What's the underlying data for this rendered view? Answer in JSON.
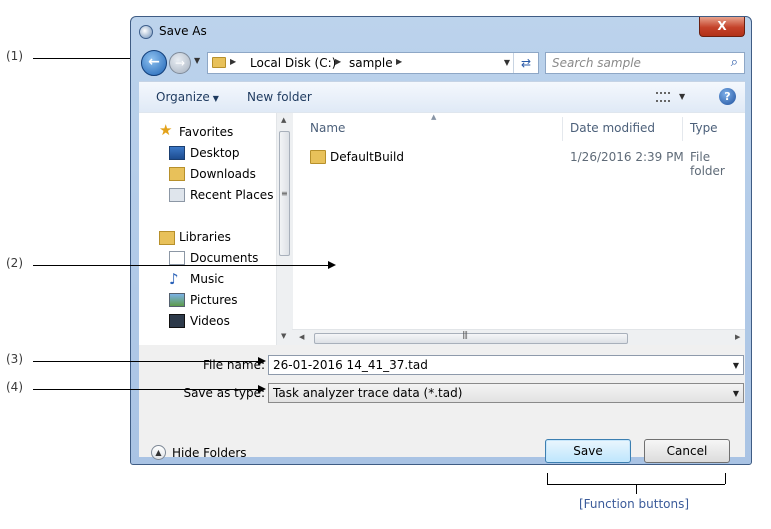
{
  "callouts": {
    "c1": "(1)",
    "c2": "(2)",
    "c3": "(3)",
    "c4": "(4)",
    "function_buttons": "[Function buttons]"
  },
  "window": {
    "title": "Save As",
    "close_glyph": "X"
  },
  "address": {
    "segments": [
      "Local Disk (C:)",
      "sample"
    ],
    "search_placeholder": "Search sample"
  },
  "toolbar": {
    "organize": "Organize",
    "new_folder": "New folder"
  },
  "nav": {
    "favorites": "Favorites",
    "desktop": "Desktop",
    "downloads": "Downloads",
    "recent_places": "Recent Places",
    "libraries": "Libraries",
    "documents": "Documents",
    "music": "Music",
    "pictures": "Pictures",
    "videos": "Videos"
  },
  "columns": {
    "name": "Name",
    "date_modified": "Date modified",
    "type": "Type"
  },
  "files": [
    {
      "name": "DefaultBuild",
      "date": "1/26/2016 2:39 PM",
      "type": "File folder"
    }
  ],
  "fields": {
    "file_name_label": "File name:",
    "file_name_value": "26-01-2016 14_41_37.tad",
    "save_as_type_label": "Save as type:",
    "save_as_type_value": "Task analyzer trace data (*.tad)"
  },
  "buttons": {
    "hide_folders": "Hide Folders",
    "save": "Save",
    "cancel": "Cancel"
  },
  "icons": {
    "back": "back-arrow-icon",
    "forward": "forward-arrow-icon",
    "refresh": "refresh-icon",
    "search": "search-icon",
    "help": "help-icon"
  }
}
